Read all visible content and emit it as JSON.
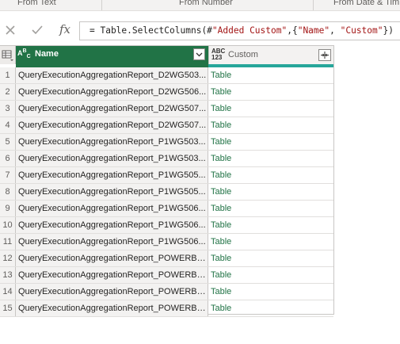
{
  "ribbon": {
    "groups": [
      {
        "label": "From Text"
      },
      {
        "label": "From Number"
      },
      {
        "label": "From Date & Tim"
      }
    ]
  },
  "formula_bar": {
    "cancel_icon": "close-icon",
    "confirm_icon": "check-icon",
    "fx_label": "fx",
    "formula_prefix": "= Table.SelectColumns(#",
    "formula_str1": "\"Added Custom\"",
    "formula_mid": ",{",
    "formula_str2": "\"Name\"",
    "formula_comma": ", ",
    "formula_str3": "\"Custom\"",
    "formula_suffix": "})"
  },
  "grid": {
    "columns": [
      {
        "type_label": "ABC",
        "label": "Name"
      },
      {
        "type_label": "ABC\n123",
        "label": "Custom"
      }
    ],
    "rows": [
      {
        "idx": "1",
        "name": "QueryExecutionAggregationReport_D2WG503...",
        "custom": "Table"
      },
      {
        "idx": "2",
        "name": "QueryExecutionAggregationReport_D2WG506...",
        "custom": "Table"
      },
      {
        "idx": "3",
        "name": "QueryExecutionAggregationReport_D2WG507...",
        "custom": "Table"
      },
      {
        "idx": "4",
        "name": "QueryExecutionAggregationReport_D2WG507...",
        "custom": "Table"
      },
      {
        "idx": "5",
        "name": "QueryExecutionAggregationReport_P1WG503...",
        "custom": "Table"
      },
      {
        "idx": "6",
        "name": "QueryExecutionAggregationReport_P1WG503...",
        "custom": "Table"
      },
      {
        "idx": "7",
        "name": "QueryExecutionAggregationReport_P1WG505...",
        "custom": "Table"
      },
      {
        "idx": "8",
        "name": "QueryExecutionAggregationReport_P1WG505...",
        "custom": "Table"
      },
      {
        "idx": "9",
        "name": "QueryExecutionAggregationReport_P1WG506...",
        "custom": "Table"
      },
      {
        "idx": "10",
        "name": "QueryExecutionAggregationReport_P1WG506...",
        "custom": "Table"
      },
      {
        "idx": "11",
        "name": "QueryExecutionAggregationReport_P1WG506...",
        "custom": "Table"
      },
      {
        "idx": "12",
        "name": "QueryExecutionAggregationReport_POWERBI-...",
        "custom": "Table"
      },
      {
        "idx": "13",
        "name": "QueryExecutionAggregationReport_POWERBI-...",
        "custom": "Table"
      },
      {
        "idx": "14",
        "name": "QueryExecutionAggregationReport_POWERBI-...",
        "custom": "Table"
      },
      {
        "idx": "15",
        "name": "QueryExecutionAggregationReport_POWERBI-...",
        "custom": "Table"
      }
    ]
  },
  "colors": {
    "name_header_bg": "#217346",
    "accent_bar": "#26a69a",
    "table_link": "#217346"
  }
}
